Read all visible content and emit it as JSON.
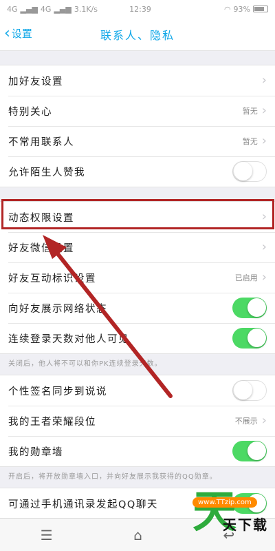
{
  "status_bar": {
    "signal1": "4G",
    "signal2": "4G",
    "speed": "3.1K/s",
    "time": "12:39",
    "battery": "93%"
  },
  "nav": {
    "back_label": "设置",
    "title": "联系人、隐私"
  },
  "section1": {
    "rows": [
      {
        "label": "加好友设置",
        "value": ""
      },
      {
        "label": "特别关心",
        "value": "暂无"
      },
      {
        "label": "不常用联系人",
        "value": "暂无"
      },
      {
        "label": "允许陌生人赞我",
        "value": ""
      }
    ]
  },
  "section2": {
    "rows": [
      {
        "label": "动态权限设置",
        "value": ""
      },
      {
        "label": "好友微信设置",
        "value": ""
      },
      {
        "label": "好友互动标识设置",
        "value": "已启用"
      },
      {
        "label": "向好友展示网络状态",
        "value": ""
      },
      {
        "label": "连续登录天数对他人可见",
        "value": ""
      }
    ],
    "note": "关闭后，他人将不可以和你PK连续登录天数。"
  },
  "section3": {
    "rows": [
      {
        "label": "个性签名同步到说说",
        "value": ""
      },
      {
        "label": "我的王者荣耀段位",
        "value": "不展示"
      },
      {
        "label": "我的勋章墙",
        "value": ""
      }
    ],
    "note": "开启后，将开放勋章墙入口，并向好友展示我获得的QQ勋章。"
  },
  "section4": {
    "rows": [
      {
        "label": "可通过手机通讯录发起QQ聊天"
      }
    ]
  },
  "watermark": {
    "brand_char": "天",
    "badge": "www.TTzip.com",
    "text": "天下载"
  },
  "colors": {
    "accent": "#12a8e8",
    "toggle_on": "#4cd964",
    "highlight": "#b22525"
  }
}
